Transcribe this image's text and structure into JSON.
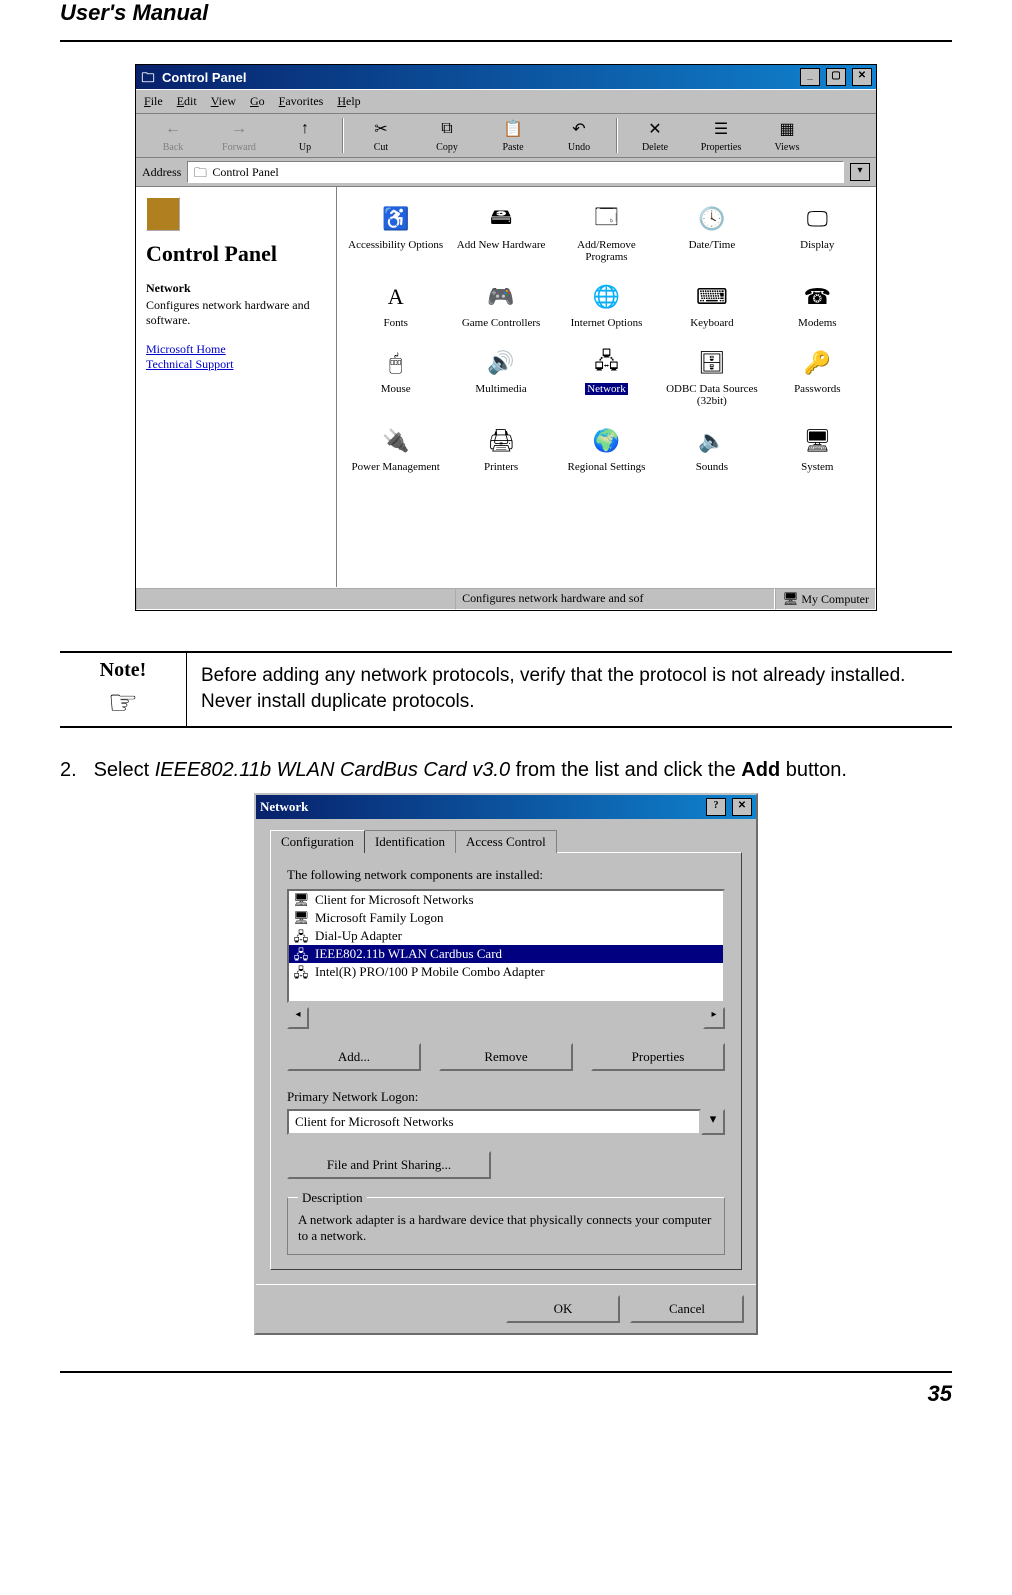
{
  "header": {
    "title": "User's Manual"
  },
  "cp_window": {
    "title": "Control Panel",
    "menus": [
      "File",
      "Edit",
      "View",
      "Go",
      "Favorites",
      "Help"
    ],
    "toolbar": [
      {
        "label": "Back",
        "enabled": false,
        "glyph": "←"
      },
      {
        "label": "Forward",
        "enabled": false,
        "glyph": "→"
      },
      {
        "label": "Up",
        "enabled": true,
        "glyph": "↑"
      },
      {
        "label": "Cut",
        "enabled": true,
        "glyph": "✂"
      },
      {
        "label": "Copy",
        "enabled": true,
        "glyph": "⧉"
      },
      {
        "label": "Paste",
        "enabled": true,
        "glyph": "📋"
      },
      {
        "label": "Undo",
        "enabled": true,
        "glyph": "↶"
      },
      {
        "label": "Delete",
        "enabled": true,
        "glyph": "✕"
      },
      {
        "label": "Properties",
        "enabled": true,
        "glyph": "☰"
      },
      {
        "label": "Views",
        "enabled": true,
        "glyph": "▦"
      }
    ],
    "address_label": "Address",
    "address_value": "Control Panel",
    "side": {
      "heading": "Control Panel",
      "item_title": "Network",
      "item_desc": "Configures network hardware and software.",
      "links": [
        "Microsoft Home",
        "Technical Support"
      ]
    },
    "icons": [
      {
        "label": "Accessibility Options",
        "glyph": "♿"
      },
      {
        "label": "Add New Hardware",
        "glyph": "🖴"
      },
      {
        "label": "Add/Remove Programs",
        "glyph": "🗔"
      },
      {
        "label": "Date/Time",
        "glyph": "🕓"
      },
      {
        "label": "Display",
        "glyph": "🖵"
      },
      {
        "label": "Fonts",
        "glyph": "A"
      },
      {
        "label": "Game Controllers",
        "glyph": "🎮"
      },
      {
        "label": "Internet Options",
        "glyph": "🌐"
      },
      {
        "label": "Keyboard",
        "glyph": "⌨"
      },
      {
        "label": "Modems",
        "glyph": "☎"
      },
      {
        "label": "Mouse",
        "glyph": "🖱"
      },
      {
        "label": "Multimedia",
        "glyph": "🔊"
      },
      {
        "label": "Network",
        "glyph": "🖧",
        "selected": true
      },
      {
        "label": "ODBC Data Sources (32bit)",
        "glyph": "🗄"
      },
      {
        "label": "Passwords",
        "glyph": "🔑"
      },
      {
        "label": "Power Management",
        "glyph": "🔌"
      },
      {
        "label": "Printers",
        "glyph": "🖨"
      },
      {
        "label": "Regional Settings",
        "glyph": "🌍"
      },
      {
        "label": "Sounds",
        "glyph": "🔈"
      },
      {
        "label": "System",
        "glyph": "🖥"
      }
    ],
    "status_left": "Configures network hardware and sof",
    "status_right": "My Computer"
  },
  "note": {
    "label": "Note!",
    "text": "Before adding any network protocols, verify that the protocol is not already installed. Never install duplicate protocols."
  },
  "instruction": {
    "number": "2.",
    "pre": "Select ",
    "italic": "IEEE802.11b WLAN CardBus Card v3.0",
    "mid": " from the list and click the ",
    "bold": "Add",
    "post": " button."
  },
  "net_dialog": {
    "title": "Network",
    "tabs": [
      "Configuration",
      "Identification",
      "Access Control"
    ],
    "active_tab": 0,
    "components_label": "The following network components are installed:",
    "components": [
      {
        "label": "Client for Microsoft Networks",
        "icon": "🖥"
      },
      {
        "label": "Microsoft Family Logon",
        "icon": "🖥"
      },
      {
        "label": "Dial-Up Adapter",
        "icon": "🖧"
      },
      {
        "label": "IEEE802.11b WLAN Cardbus Card",
        "icon": "🖧",
        "selected": true
      },
      {
        "label": "Intel(R) PRO/100 P Mobile Combo Adapter",
        "icon": "🖧"
      }
    ],
    "buttons": {
      "add": "Add...",
      "remove": "Remove",
      "properties": "Properties"
    },
    "primary_logon_label": "Primary Network Logon:",
    "primary_logon_value": "Client for Microsoft Networks",
    "file_print": "File and Print Sharing...",
    "desc_label": "Description",
    "desc_text": "A network adapter is a hardware device that physically connects your computer to a network.",
    "ok": "OK",
    "cancel": "Cancel"
  },
  "page_number": "35"
}
